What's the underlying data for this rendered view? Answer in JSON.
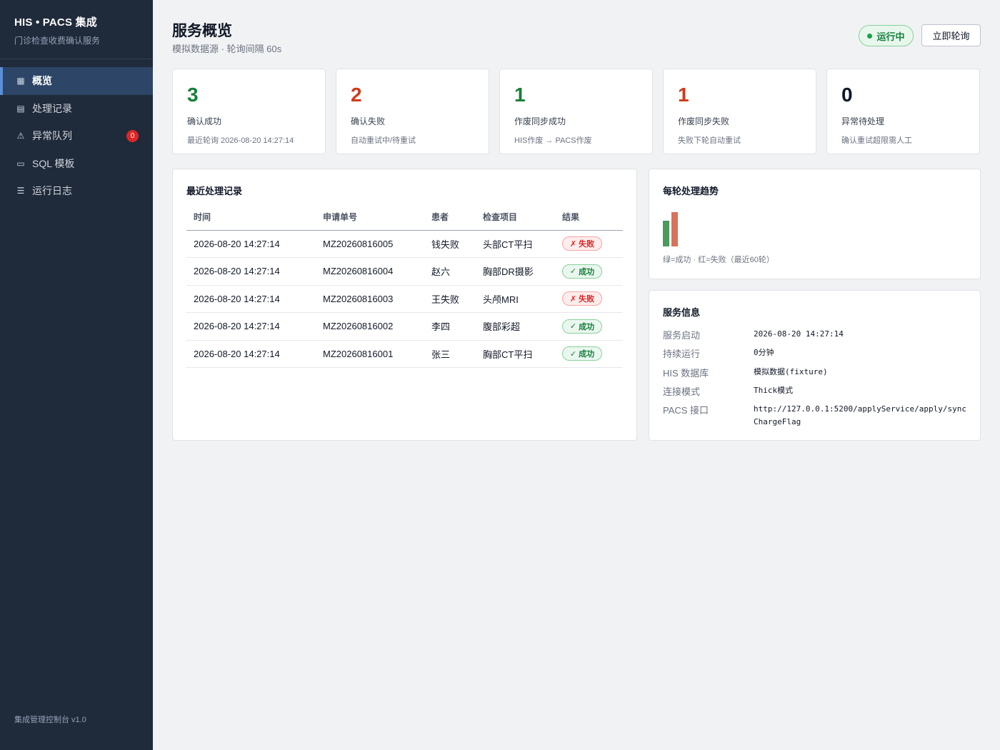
{
  "sidebar": {
    "brand_title": "HIS • PACS 集成",
    "brand_sub": "门诊检查收费确认服务",
    "items": [
      {
        "label": "概览",
        "icon": "grid-icon",
        "glyph": "▦"
      },
      {
        "label": "处理记录",
        "icon": "list-icon",
        "glyph": "▤"
      },
      {
        "label": "异常队列",
        "icon": "warning-icon",
        "glyph": "⚠",
        "badge": "0"
      },
      {
        "label": "SQL 模板",
        "icon": "database-icon",
        "glyph": "▭"
      },
      {
        "label": "运行日志",
        "icon": "menu-icon",
        "glyph": "☰"
      }
    ],
    "footer": "集成管理控制台 v1.0"
  },
  "header": {
    "title": "服务概览",
    "subtitle": "模拟数据源 · 轮询间隔 60s",
    "status": "运行中",
    "poll_button": "立即轮询"
  },
  "stats": [
    {
      "value": "3",
      "label": "确认成功",
      "sub": "最近轮询 2026-08-20 14:27:14",
      "color": "#16803a"
    },
    {
      "value": "2",
      "label": "确认失败",
      "sub": "自动重试中/待重试",
      "color": "#d03a1a"
    },
    {
      "value": "1",
      "label": "作废同步成功",
      "sub": "HIS作废 → PACS作废",
      "color": "#16803a"
    },
    {
      "value": "1",
      "label": "作废同步失败",
      "sub": "失败下轮自动重试",
      "color": "#d03a1a"
    },
    {
      "value": "0",
      "label": "异常待处理",
      "sub": "确认重试超限需人工",
      "color": "#111827"
    }
  ],
  "records": {
    "title": "最近处理记录",
    "columns": [
      "时间",
      "申请单号",
      "患者",
      "检查项目",
      "结果"
    ],
    "rows": [
      {
        "time": "2026-08-20 14:27:14",
        "id": "MZ20260816005",
        "patient": "钱失败",
        "item": "头部CT平扫",
        "result": "失败",
        "status": "fail",
        "mark": "✗"
      },
      {
        "time": "2026-08-20 14:27:14",
        "id": "MZ20260816004",
        "patient": "赵六",
        "item": "胸部DR摄影",
        "result": "成功",
        "status": "ok",
        "mark": "✓"
      },
      {
        "time": "2026-08-20 14:27:14",
        "id": "MZ20260816003",
        "patient": "王失败",
        "item": "头颅MRI",
        "result": "失败",
        "status": "fail",
        "mark": "✗"
      },
      {
        "time": "2026-08-20 14:27:14",
        "id": "MZ20260816002",
        "patient": "李四",
        "item": "腹部彩超",
        "result": "成功",
        "status": "ok",
        "mark": "✓"
      },
      {
        "time": "2026-08-20 14:27:14",
        "id": "MZ20260816001",
        "patient": "张三",
        "item": "胸部CT平扫",
        "result": "成功",
        "status": "ok",
        "mark": "✓"
      }
    ]
  },
  "trend": {
    "title": "每轮处理趋势",
    "caption": "绿=成功 · 红=失败（最近60轮）",
    "success_color": "#4a9a5c",
    "fail_color": "#d9725a"
  },
  "chart_data": {
    "type": "bar",
    "categories": [
      ""
    ],
    "series": [
      {
        "values": [
          3
        ]
      },
      {
        "values": [
          4
        ]
      }
    ]
  },
  "service": {
    "title": "服务信息",
    "rows": [
      {
        "key": "服务启动",
        "value": "2026-08-20 14:27:14"
      },
      {
        "key": "持续运行",
        "value": "0分钟"
      },
      {
        "key": "HIS 数据库",
        "value": "模拟数据(fixture)"
      },
      {
        "key": "连接模式",
        "value": "Thick模式"
      },
      {
        "key": "PACS 接口",
        "value": "http://127.0.0.1:5200/applyService/apply/syncChargeFlag"
      }
    ]
  }
}
